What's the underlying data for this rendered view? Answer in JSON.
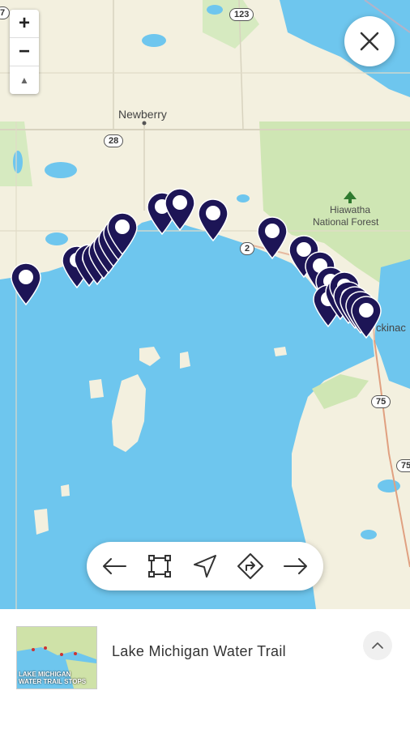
{
  "map": {
    "zoom_in_label": "+",
    "zoom_out_label": "−",
    "compass_label": "▲",
    "labels": {
      "newberry": "Newberry",
      "forest_line1": "Hiawatha",
      "forest_line2": "National Forest",
      "mackinac_partial": "ckinac"
    },
    "road_shields": {
      "r123": "123",
      "r28": "28",
      "r2": "2",
      "r75a": "75",
      "r75b": "75",
      "r7": "7"
    },
    "pin_count": 23
  },
  "toolbar": {
    "back_icon": "arrow-left-icon",
    "fit_icon": "bounding-box-icon",
    "locate_icon": "navigation-arrow-icon",
    "route_icon": "directions-icon",
    "forward_icon": "arrow-right-icon"
  },
  "close_icon": "close-icon",
  "bottom_panel": {
    "title": "Lake Michigan Water Trail",
    "thumbnail_caption_line1": "LAKE MICHIGAN",
    "thumbnail_caption_line2": "WATER TRAIL STOPS",
    "expand_icon": "chevron-up-icon"
  },
  "colors": {
    "water": "#6ec6ee",
    "land": "#f3f0df",
    "forest": "#cfe6b4",
    "pin": "#1d1556"
  }
}
